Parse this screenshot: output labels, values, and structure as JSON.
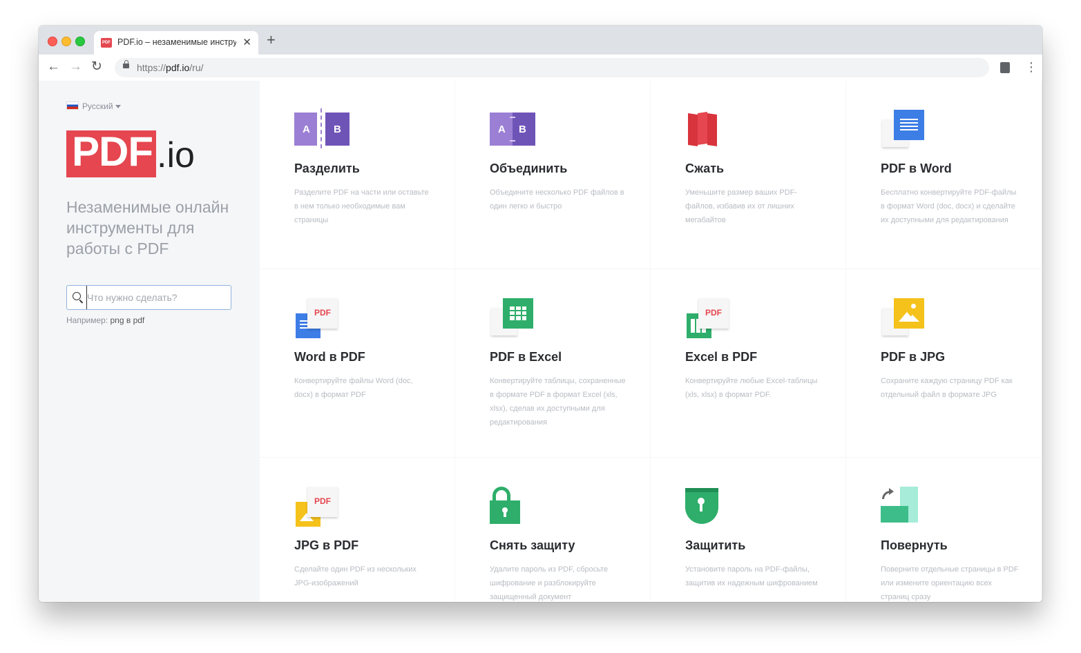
{
  "browser": {
    "tab_title": "PDF.io – незаменимые инструменты",
    "tab_favicon": "PDF",
    "tab_close": "✕",
    "new_tab": "+",
    "back": "←",
    "forward": "→",
    "reload": "↻",
    "url_scheme": "https://",
    "url_host": "pdf.io",
    "url_path": "/ru/",
    "menu": "⋮"
  },
  "sidebar": {
    "language": "Русский",
    "logo_main": "PDF",
    "logo_suffix": ".io",
    "tagline": "Незаменимые онлайн инструменты для работы с PDF",
    "search_placeholder": "Что нужно сделать?",
    "example_label": "Например:",
    "example_value": "png в pdf"
  },
  "tools": [
    {
      "icon": "split-icon",
      "title": "Разделить",
      "desc": "Разделите PDF на части или оставьте в нем только необходимые вам страницы"
    },
    {
      "icon": "merge-icon",
      "title": "Объединить",
      "desc": "Объедините несколько PDF файлов в один легко и быстро"
    },
    {
      "icon": "compress-icon",
      "title": "Сжать",
      "desc": "Уменьшите размер ваших PDF-файлов, избавив их от лишних мегабайтов"
    },
    {
      "icon": "pdf-to-word-icon",
      "title": "PDF в Word",
      "desc": "Бесплатно конвертируйте PDF-файлы в формат Word (doc, docx) и сделайте их доступными для редактирования"
    },
    {
      "icon": "word-to-pdf-icon",
      "title": "Word в PDF",
      "desc": "Конвертируйте файлы Word (doc, docx) в формат PDF"
    },
    {
      "icon": "pdf-to-excel-icon",
      "title": "PDF в Excel",
      "desc": "Конвертируйте таблицы, сохраненные в формате PDF в формат Excel (xls, xlsx), сделав их доступными для редактирования"
    },
    {
      "icon": "excel-to-pdf-icon",
      "title": "Excel в PDF",
      "desc": "Конвертируйте любые Excel-таблицы (xls, xlsx) в формат PDF."
    },
    {
      "icon": "pdf-to-jpg-icon",
      "title": "PDF в JPG",
      "desc": "Сохраните каждую страницу PDF как отдельный файл в формате JPG"
    },
    {
      "icon": "jpg-to-pdf-icon",
      "title": "JPG в PDF",
      "desc": "Сделайте один PDF из нескольких JPG-изображений"
    },
    {
      "icon": "unlock-icon",
      "title": "Снять защиту",
      "desc": "Удалите пароль из PDF, сбросьте шифрование и разблокируйте защищенный документ"
    },
    {
      "icon": "protect-icon",
      "title": "Защитить",
      "desc": "Установите пароль на PDF-файлы, защитив их надежным шифрованием"
    },
    {
      "icon": "rotate-icon",
      "title": "Повернуть",
      "desc": "Поверните отдельные страницы в PDF или измените ориентацию всех страниц сразу"
    }
  ],
  "icon_text": {
    "a": "A",
    "b": "B",
    "pdf": "PDF"
  },
  "colors": {
    "brand_red": "#e5464f",
    "purple": "#7b5fc1",
    "blue": "#3d7de6",
    "green": "#2eae6a",
    "yellow": "#f5c21b",
    "teal": "#3dbd8a"
  }
}
